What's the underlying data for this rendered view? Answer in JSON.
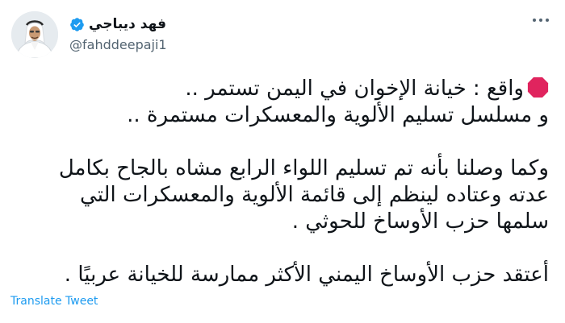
{
  "author": {
    "display_name": "فهد ديباجي",
    "handle": "@fahddeepaji1",
    "verified": true
  },
  "tweet": {
    "paragraph1": {
      "icon": "stop-sign-icon",
      "line1": "واقع : خيانة الإخوان في اليمن تستمر ..",
      "line2": "و مسلسل تسليم الألوية والمعسكرات مستمرة .."
    },
    "paragraph2": {
      "line1": "وكما وصلنا بأنه تم تسليم اللواء الرابع مشاه بالجاح بكامل",
      "line2": "عدته وعتاده لينظم إلى قائمة الألوية والمعسكرات التي",
      "line3": "سلمها حزب الأوساخ للحوثي ."
    },
    "paragraph3": {
      "line1": "أعتقد حزب الأوساخ اليمني الأكثر ممارسة للخيانة عربيًا ."
    }
  },
  "actions": {
    "translate_label": "Translate Tweet",
    "more_icon": "more-options-icon"
  },
  "colors": {
    "accent": "#1d9bf0",
    "text": "#0f1419",
    "muted": "#536471",
    "stop_sign": "#e0245e"
  }
}
